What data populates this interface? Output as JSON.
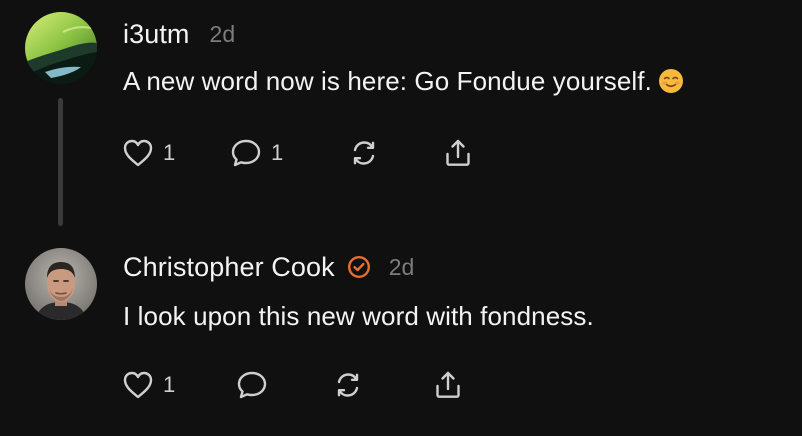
{
  "posts": [
    {
      "username": "i3utm",
      "timestamp": "2d",
      "text": "A new word now is here: Go Fondue yourself.",
      "verified": false,
      "likes": "1",
      "replies": "1",
      "has_emoji": true,
      "emoji_icon": "relieved-face-emoji-icon"
    },
    {
      "username": "Christopher Cook",
      "timestamp": "2d",
      "text": "I look upon this new word with fondness.",
      "verified": true,
      "likes": "1",
      "replies": "",
      "has_emoji": false
    }
  ],
  "colors": {
    "background": "#101010",
    "text": "#f3f3f3",
    "muted": "#7d7d7d",
    "icon": "#cfcfcf",
    "thread_line": "#3a3a3a",
    "verified": "#e8702a",
    "emoji": "#f6b93b"
  },
  "icons": {
    "like": "heart-icon",
    "reply": "comment-bubble-icon",
    "repost": "repost-icon",
    "share": "share-icon",
    "verified": "verified-badge-icon"
  }
}
